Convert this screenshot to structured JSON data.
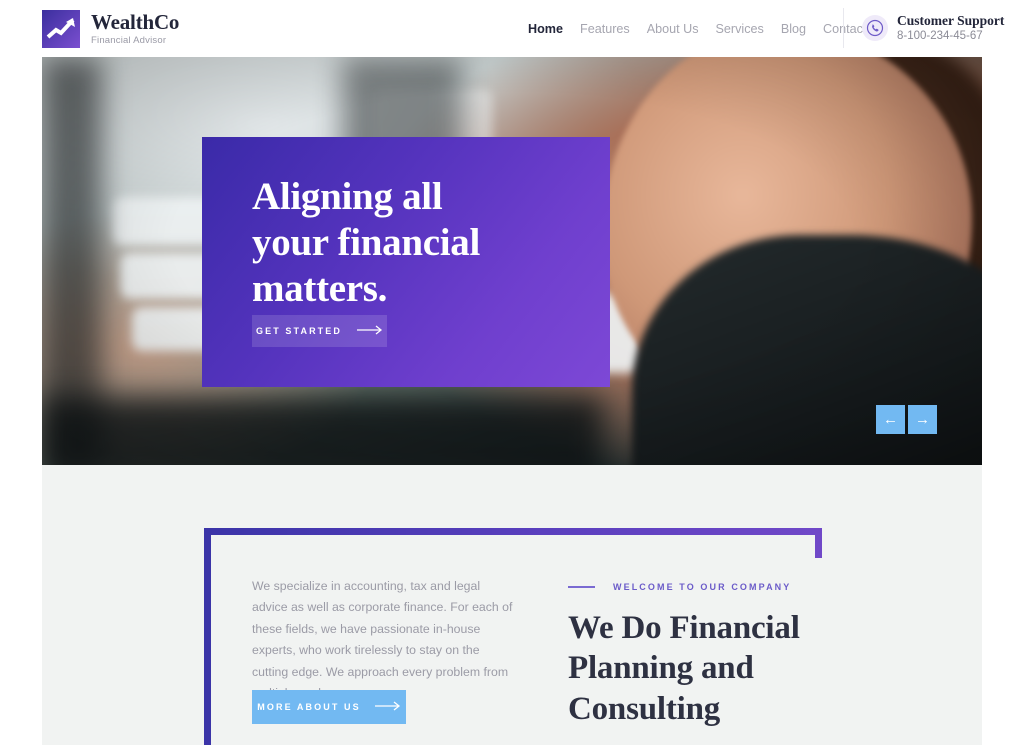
{
  "header": {
    "brand": {
      "title": "WealthCo",
      "subtitle": "Financial Advisor",
      "logo_icon": "chart-line-up-icon",
      "logo_gradient_from": "#3b2f9e",
      "logo_gradient_to": "#7b4fd0"
    },
    "nav": [
      {
        "label": "Home",
        "active": true
      },
      {
        "label": "Features",
        "active": false
      },
      {
        "label": "About Us",
        "active": false
      },
      {
        "label": "Services",
        "active": false
      },
      {
        "label": "Blog",
        "active": false
      },
      {
        "label": "Contacts",
        "active": false
      }
    ],
    "support": {
      "icon": "phone-circle-icon",
      "title": "Customer Support",
      "phone": "8-100-234-45-67",
      "icon_color": "#6f5bc8"
    }
  },
  "hero": {
    "photo_alt": "smiling businesswoman in profile in a bright office",
    "card": {
      "title_line1": "Aligning all",
      "title_line2": "your financial",
      "title_line3": "matters.",
      "gradient_from": "#3a2aa8",
      "gradient_to": "#7d48d6",
      "button_label": "GET STARTED",
      "button_icon": "arrow-right-icon"
    },
    "slider": {
      "prev_icon": "arrow-left-icon",
      "prev_glyph": "←",
      "next_icon": "arrow-right-icon",
      "next_glyph": "→",
      "color": "#72b9f2"
    }
  },
  "about": {
    "body": "We specialize in accounting, tax and legal advice as well as corporate finance. For each of these fields, we have passionate in-house experts, who work tirelessly to stay on the cutting edge. We approach every problem from multiple angles.",
    "button_label": "MORE ABOUT US",
    "button_icon": "arrow-right-icon",
    "button_color": "#72b9f2",
    "eyebrow": "WELCOME TO OUR COMPANY",
    "eyebrow_color": "#6b5bc9",
    "heading_line1": "We Do Financial",
    "heading_line2": "Planning and",
    "heading_line3": "Consulting",
    "frame_color_start": "#3b34a8",
    "frame_color_end": "#7048c8",
    "band_color": "#f1f3f2"
  }
}
